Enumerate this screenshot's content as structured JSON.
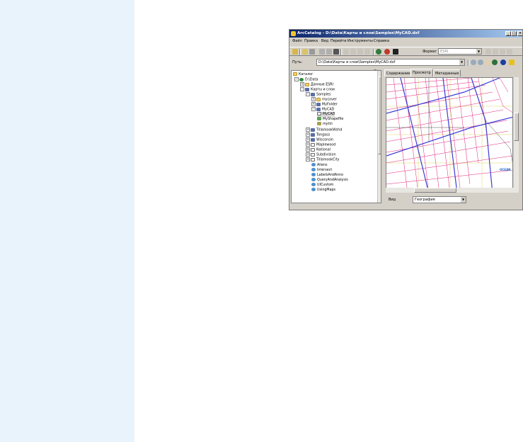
{
  "window": {
    "title": "ArcCatalog - D:\\Data\\Карты и слои\\Samples\\MyCAD.dxf"
  },
  "menu": [
    "Файл",
    "Правка",
    "Вид",
    "Перейти",
    "Инструменты",
    "Справка"
  ],
  "toolbar": {
    "format_label": "Формат",
    "format_value": "ESRI"
  },
  "path": {
    "label": "Путь:",
    "value": "D:\\Data\\Карты и слои\\Samples\\MyCAD.dxf"
  },
  "tree": {
    "items": [
      "Каталог",
      "D:\\Data",
      "Данные ESRI",
      "Карты и слои",
      "Samples",
      "mycover",
      "MyFolder",
      "MyCAD",
      "MyCAD",
      "MyShapefile",
      "mytin",
      "TillamookWshd",
      "Tongass",
      "Wisconsin",
      "Maplewood",
      "National",
      "Subdivision",
      "TillamookCity",
      "Aliens",
      "Intersect",
      "LabelsAndAnno",
      "QueryAndAnalysis",
      "UICustom",
      "UsingMaps"
    ]
  },
  "tabs": [
    "Содержание",
    "Просмотр",
    "Метаданные"
  ],
  "map": {
    "ocean_label": "OCEAN"
  },
  "view": {
    "label": "Вид",
    "value": "География"
  },
  "colors": {
    "title_start": "#0a246a",
    "title_end": "#a6caf0",
    "chrome": "#d4d0c8",
    "margin": "#e8f3fb",
    "callout": "#1f64b8",
    "parcels": "#e0207a",
    "roads": "#3b3bd6",
    "grid": "#d8d860"
  }
}
